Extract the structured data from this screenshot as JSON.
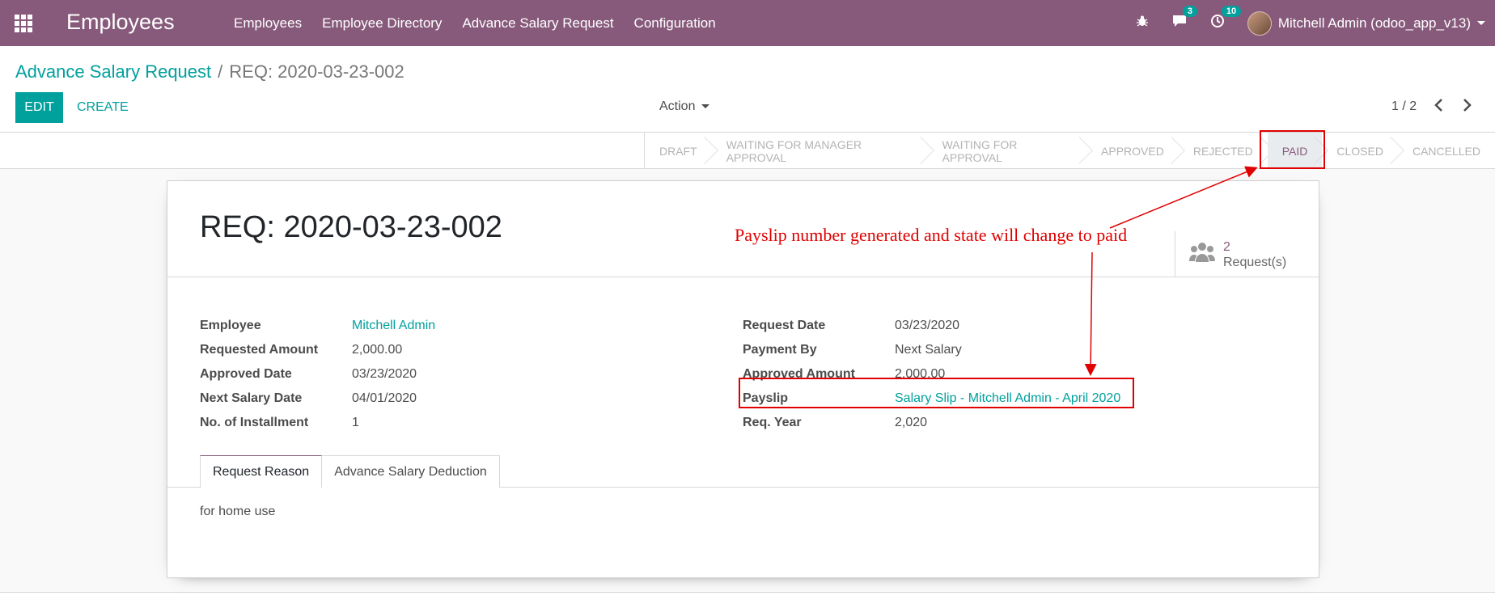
{
  "navbar": {
    "app_title": "Employees",
    "menu": [
      "Employees",
      "Employee Directory",
      "Advance Salary Request",
      "Configuration"
    ],
    "messages_count": "3",
    "activities_count": "10",
    "user_name": "Mitchell Admin (odoo_app_v13)"
  },
  "breadcrumb": {
    "parent": "Advance Salary Request",
    "separator": "/",
    "current": "REQ: 2020-03-23-002"
  },
  "buttons": {
    "edit": "EDIT",
    "create": "CREATE",
    "action": "Action"
  },
  "pager": {
    "text": "1 / 2",
    "prev": "‹",
    "next": "›"
  },
  "statusbar": {
    "stages": [
      "DRAFT",
      "WAITING FOR MANAGER APPROVAL",
      "WAITING FOR APPROVAL",
      "APPROVED",
      "REJECTED",
      "PAID",
      "CLOSED",
      "CANCELLED"
    ],
    "active": "PAID"
  },
  "record": {
    "title": "REQ: 2020-03-23-002",
    "smart_button": {
      "count": "2",
      "label": "Request(s)"
    },
    "left_fields": [
      {
        "label": "Employee",
        "value": "Mitchell Admin"
      },
      {
        "label": "Requested Amount",
        "value": "2,000.00"
      },
      {
        "label": "Approved Date",
        "value": "03/23/2020"
      },
      {
        "label": "Next Salary Date",
        "value": "04/01/2020"
      },
      {
        "label": "No. of Installment",
        "value": "1"
      }
    ],
    "right_fields": [
      {
        "label": "Request Date",
        "value": "03/23/2020"
      },
      {
        "label": "Payment By",
        "value": "Next Salary"
      },
      {
        "label": "Approved Amount",
        "value": "2,000.00"
      },
      {
        "label": "Payslip",
        "value": "Salary Slip - Mitchell Admin - April 2020"
      },
      {
        "label": "Req. Year",
        "value": "2,020"
      }
    ],
    "tabs": [
      "Request Reason",
      "Advance Salary Deduction"
    ],
    "tab_content": "for home use"
  },
  "annotation": {
    "text": "Payslip number generated and state will change to paid",
    "color": "#e00000"
  },
  "colors": {
    "navbar": "#875a7b",
    "accent": "#00a09d"
  }
}
